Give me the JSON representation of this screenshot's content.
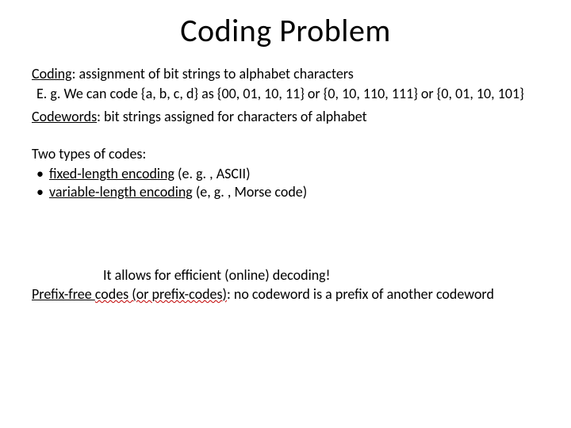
{
  "title": "Coding Problem",
  "def_coding": {
    "term": "Coding",
    "rest": ": assignment of bit strings to alphabet characters"
  },
  "example_prefix": "E. g.  We can code {a, b, c, d} as {00, 01, 10, 11} or {0, 10, 110, 111} or {0, 01, 10, 101}",
  "def_codewords": {
    "term": "Codewords",
    "rest": ": bit strings assigned for characters of alphabet"
  },
  "types_heading": "Two types of codes:",
  "bullet_fixed": {
    "term": "fixed-length encoding",
    "rest": " (e. g. , ASCII)"
  },
  "bullet_var": {
    "term": "variable-length encoding",
    "rest": " (e, g. , Morse code)"
  },
  "callout": "It allows for efficient (online) decoding!",
  "prefix_line": {
    "term_plain": "Prefix-free ",
    "term_squiggle": "codes (or prefix-codes)",
    "rest": ": no codeword is a prefix of another codeword"
  }
}
